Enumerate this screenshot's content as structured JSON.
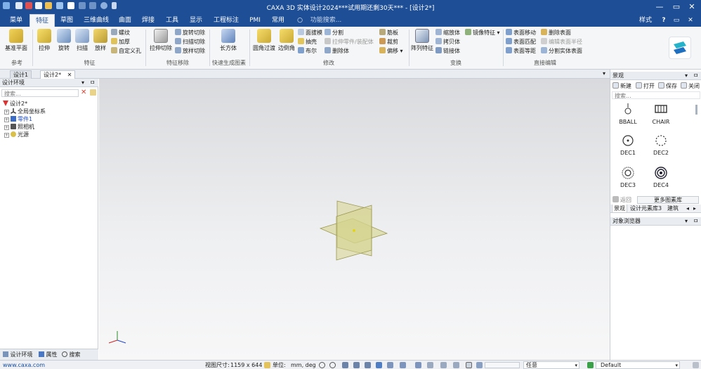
{
  "window": {
    "title": "CAXA 3D 实体设计2024***试用期还剩30天*** - [设计2*]",
    "controls": {
      "minimize": "—",
      "maximize": "▭",
      "close": "✕"
    }
  },
  "menu": {
    "tabs": [
      "菜单",
      "特征",
      "草图",
      "三维曲线",
      "曲面",
      "焊接",
      "工具",
      "显示",
      "工程标注",
      "PMI",
      "常用"
    ],
    "active": "特征",
    "search_placeholder": "功能搜索...",
    "style_label": "样式",
    "help_label": "?"
  },
  "ribbon": {
    "groups": {
      "ref": "参考",
      "feature": "特征",
      "feature_move": "特征移除",
      "quick": "快速生成图素",
      "modify": "修改",
      "transform": "变换",
      "direct": "直接编辑"
    },
    "buttons": {
      "datum_plane": "基准平面",
      "extrude": "拉伸",
      "revolve": "旋转",
      "sweep": "扫描",
      "loft": "放样",
      "thread": "螺纹",
      "thicken": "加厚",
      "custom_hole": "自定义孔",
      "extrude_cut": "拉伸切除",
      "revolve_cut": "旋转切除",
      "sweep_cut": "扫描切除",
      "loft_cut": "放样切除",
      "cuboid": "长方体",
      "fillet": "圆角过渡",
      "chamfer": "边倒角",
      "face_draft": "面拔模",
      "shell": "抽壳",
      "boolean": "布尔",
      "split": "分割",
      "stretch_part": "拉伸零件/装配体",
      "delete_body": "删除体",
      "rib": "筋板",
      "trim": "裁剪",
      "offset": "偏移",
      "array": "阵列特征",
      "scale": "缩放体",
      "copy_body": "拷贝体",
      "link_body": "链接体",
      "mirror": "镜像特征",
      "face_move": "表面移动",
      "face_match": "表面匹配",
      "face_equidist": "表面等距",
      "delete_face": "删除表面",
      "edit_radius": "编辑表面半径",
      "split_face": "分割实体表面"
    }
  },
  "doc_tabs": [
    "设计1",
    "设计2*"
  ],
  "left_panel": {
    "title": "设计环境",
    "search_placeholder": "搜索...",
    "tree": [
      "设计2*",
      "全局坐标系",
      "零件1",
      "照相机",
      "光源"
    ],
    "bottom_tabs": [
      "设计环境",
      "属性",
      "搜索"
    ]
  },
  "right_panel": {
    "scene_title": "景观",
    "toolbar": [
      "新建",
      "打开",
      "保存",
      "关闭"
    ],
    "search_placeholder": "搜索...",
    "items": [
      "BBALL",
      "CHAIR",
      "DEC1",
      "DEC2",
      "DEC3",
      "DEC4"
    ],
    "back_label": "返回",
    "more_label": "更多图素库",
    "tabs": [
      "景观",
      "设计元素库3",
      "建筑"
    ],
    "browser_title": "对象浏览器"
  },
  "statusbar": {
    "url": "www.caxa.com",
    "view_size_label": "视图尺寸:",
    "view_size": "1159 x 644",
    "unit_label": "单位:",
    "unit_value": "mm, deg",
    "selector": "任意",
    "scheme": "Default"
  },
  "colors": {
    "title_blue": "#1e4f96",
    "ribbon_bg": "#f5f6f7",
    "plane_fill": "#d4d08a",
    "plane_stroke": "#9a9750"
  }
}
